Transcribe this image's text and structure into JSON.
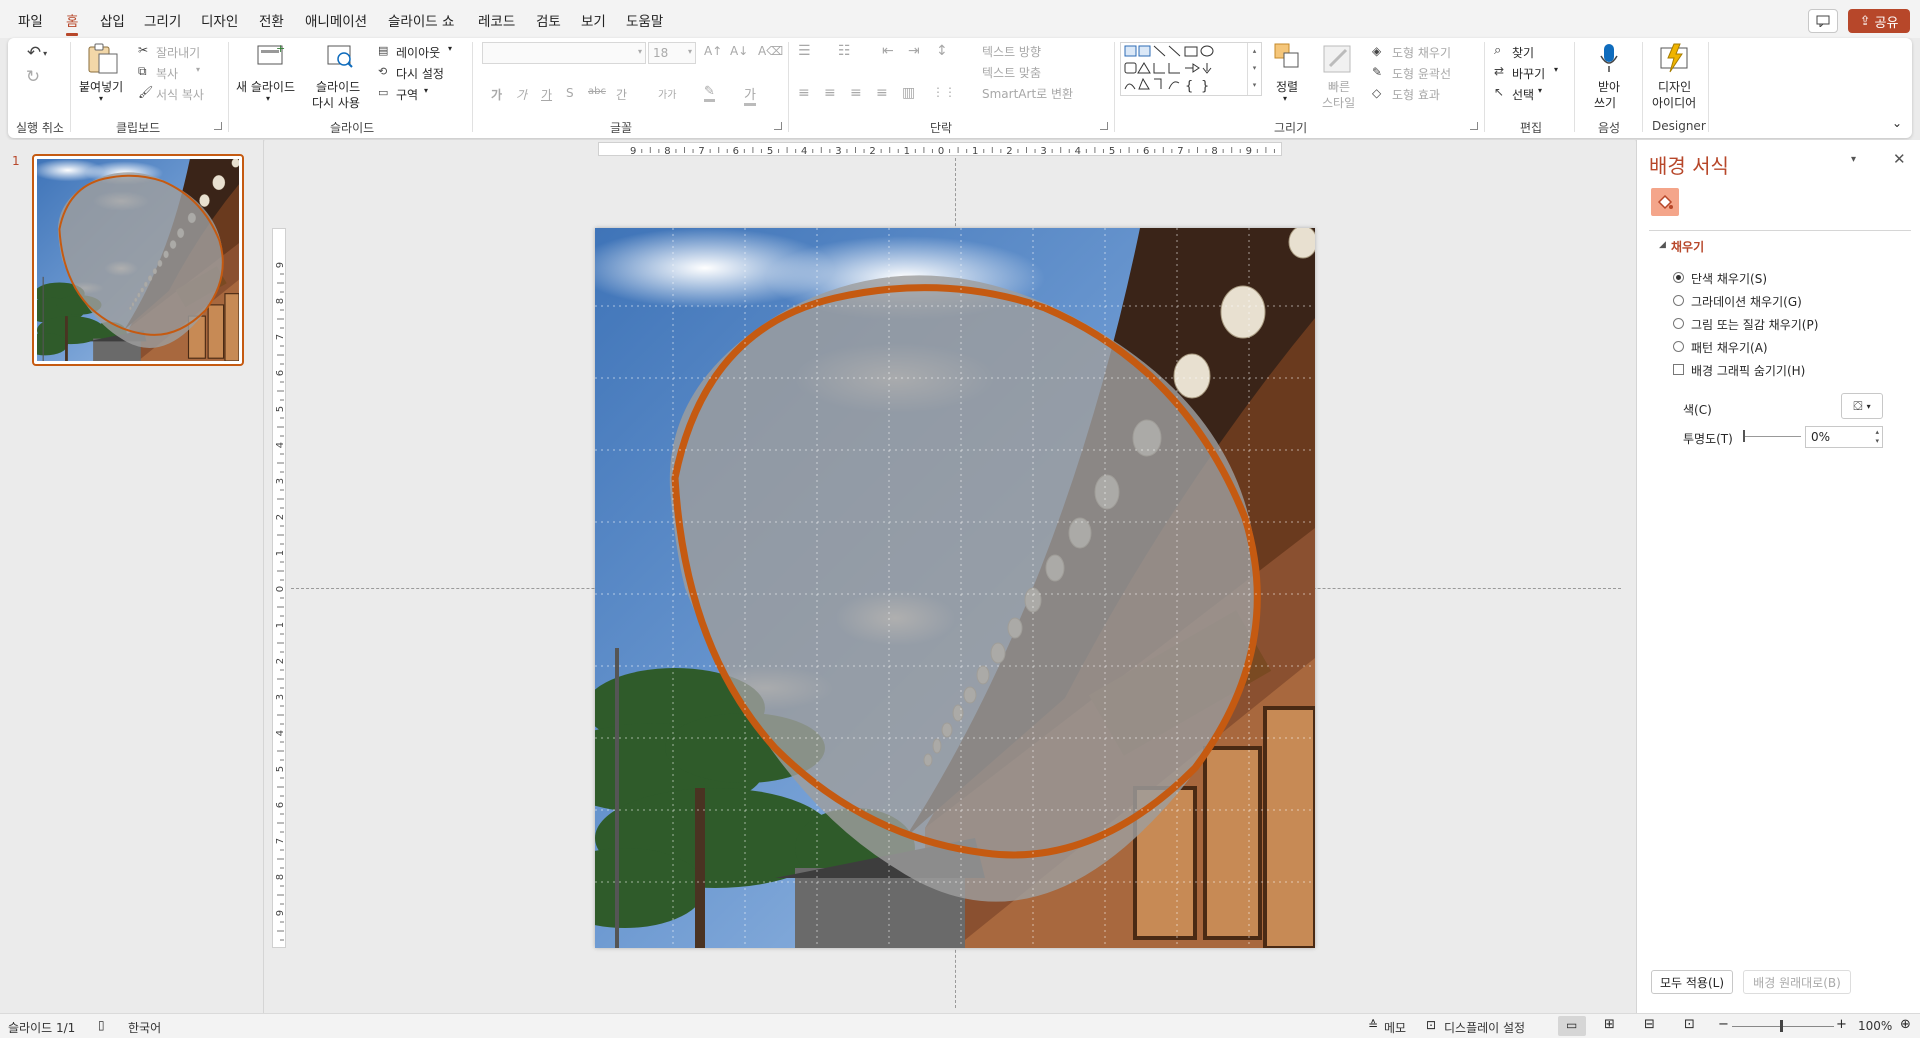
{
  "menu": [
    "파일",
    "홈",
    "삽입",
    "그리기",
    "디자인",
    "전환",
    "애니메이션",
    "슬라이드 쇼",
    "레코드",
    "검토",
    "보기",
    "도움말"
  ],
  "menu_active_index": 1,
  "share_label": "공유",
  "ribbon": {
    "undo_group": "실행 취소",
    "clipboard": {
      "group": "클립보드",
      "paste": "붙여넣기",
      "cut": "잘라내기",
      "copy": "복사",
      "format_painter": "서식 복사"
    },
    "slides": {
      "group": "슬라이드",
      "new_slide": "새 슬라이드",
      "reuse_slide_1": "슬라이드",
      "reuse_slide_2": "다시 사용",
      "layout": "레이아웃",
      "reset": "다시 설정",
      "section": "구역"
    },
    "font": {
      "group": "글꼴",
      "font_size": "18",
      "bold": "가",
      "italic": "가",
      "underline": "가",
      "strike": "S",
      "shadow": "abc",
      "spacing": "간",
      "case": "가가"
    },
    "paragraph": {
      "group": "단락",
      "text_direction": "텍스트 방향",
      "align_text": "텍스트 맞춤",
      "smartart": "SmartArt로 변환"
    },
    "drawing": {
      "group": "그리기",
      "arrange": "정렬",
      "quick_styles_1": "빠른",
      "quick_styles_2": "스타일",
      "shape_fill": "도형 채우기",
      "shape_outline": "도형 윤곽선",
      "shape_effects": "도형 효과"
    },
    "editing": {
      "group": "편집",
      "find": "찾기",
      "replace": "바꾸기",
      "select": "선택"
    },
    "voice": {
      "group": "음성",
      "dictate_1": "받아",
      "dictate_2": "쓰기"
    },
    "designer": {
      "group": "Designer",
      "ideas_1": "디자인",
      "ideas_2": "아이디어"
    }
  },
  "thumbnail_number": "1",
  "ruler": {
    "h_ticks": [
      "9",
      "8",
      "7",
      "6",
      "5",
      "4",
      "3",
      "2",
      "1",
      "0",
      "1",
      "2",
      "3",
      "4",
      "5",
      "6",
      "7",
      "8",
      "9"
    ],
    "v_ticks": [
      "9",
      "8",
      "7",
      "6",
      "5",
      "4",
      "3",
      "2",
      "1",
      "0",
      "1",
      "2",
      "3",
      "4",
      "5",
      "6",
      "7",
      "8",
      "9"
    ]
  },
  "format_pane": {
    "title": "배경 서식",
    "section": "채우기",
    "options": [
      {
        "label": "단색 채우기(S)",
        "selected": true
      },
      {
        "label": "그라데이션 채우기(G)",
        "selected": false
      },
      {
        "label": "그림 또는 질감 채우기(P)",
        "selected": false
      },
      {
        "label": "패턴 채우기(A)",
        "selected": false
      }
    ],
    "hide_graphics": "배경 그래픽 숨기기(H)",
    "color_label": "색(C)",
    "transparency_label": "투명도(T)",
    "transparency_value": "0%",
    "apply_all": "모두 적용(L)",
    "reset_bg": "배경 원래대로(B)"
  },
  "status": {
    "slide_count": "슬라이드 1/1",
    "language": "한국어",
    "notes": "메모",
    "display": "디스플레이 설정",
    "zoom": "100%"
  },
  "colors": {
    "accent": "#b7472a",
    "shape_outline": "#c55a11"
  }
}
